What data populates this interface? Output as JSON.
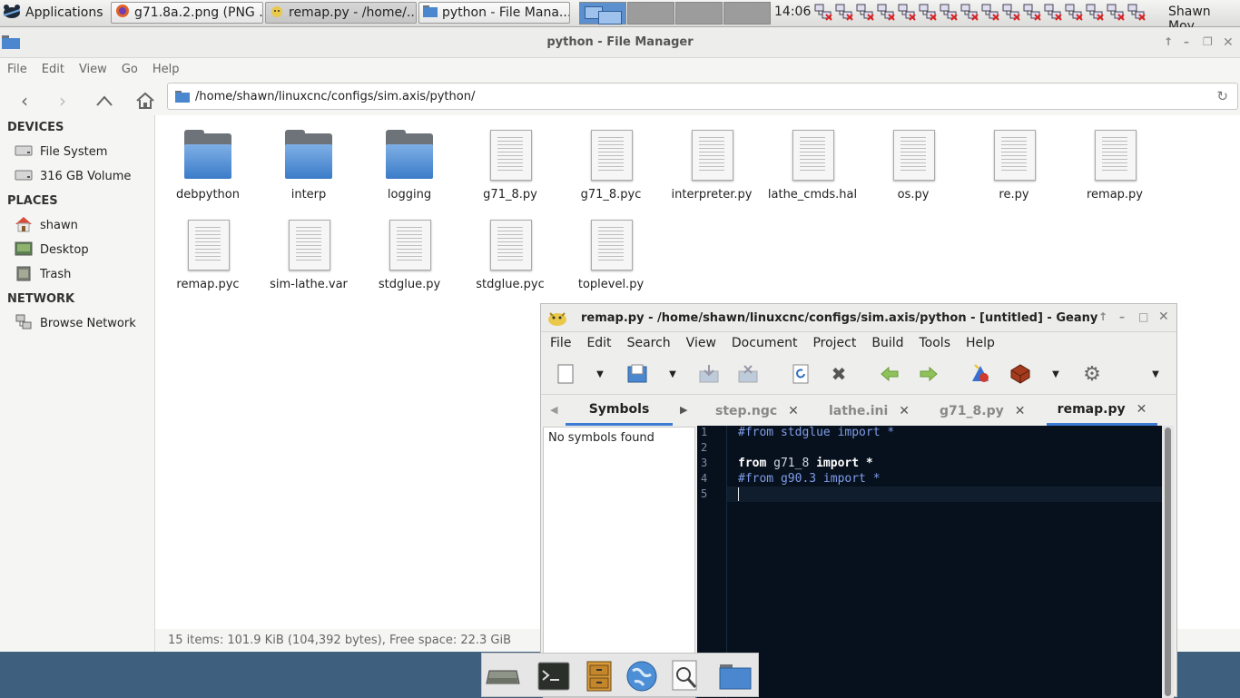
{
  "top_panel": {
    "apps_label": "Applications",
    "tasks": [
      {
        "label": "g71.8a.2.png (PNG ...",
        "icon": "firefox-icon"
      },
      {
        "label": "remap.py - /home/...",
        "icon": "geany-icon"
      },
      {
        "label": "python - File Mana...",
        "icon": "folder-icon"
      }
    ],
    "clock": "14:06",
    "user": "Shawn Moy"
  },
  "file_manager": {
    "title": "python - File Manager",
    "menu": [
      "File",
      "Edit",
      "View",
      "Go",
      "Help"
    ],
    "path": "/home/shawn/linuxcnc/configs/sim.axis/python/",
    "sidebar": {
      "devices_heading": "DEVICES",
      "devices": [
        "File System",
        "316 GB Volume"
      ],
      "places_heading": "PLACES",
      "places": [
        "shawn",
        "Desktop",
        "Trash"
      ],
      "network_heading": "NETWORK",
      "network": [
        "Browse Network"
      ]
    },
    "files": [
      {
        "name": "debpython",
        "type": "folder"
      },
      {
        "name": "interp",
        "type": "folder"
      },
      {
        "name": "logging",
        "type": "folder"
      },
      {
        "name": "g71_8.py",
        "type": "file"
      },
      {
        "name": "g71_8.pyc",
        "type": "file"
      },
      {
        "name": "interpreter.py",
        "type": "file"
      },
      {
        "name": "lathe_cmds.hal",
        "type": "file"
      },
      {
        "name": "os.py",
        "type": "file"
      },
      {
        "name": "re.py",
        "type": "file"
      },
      {
        "name": "remap.py",
        "type": "file"
      },
      {
        "name": "remap.pyc",
        "type": "file"
      },
      {
        "name": "sim-lathe.var",
        "type": "file"
      },
      {
        "name": "stdglue.py",
        "type": "file"
      },
      {
        "name": "stdglue.pyc",
        "type": "file"
      },
      {
        "name": "toplevel.py",
        "type": "file"
      }
    ],
    "status": "15 items: 101.9 KiB (104,392 bytes), Free space: 22.3 GiB"
  },
  "geany": {
    "title": "remap.py - /home/shawn/linuxcnc/configs/sim.axis/python - [untitled] - Geany",
    "menu": [
      "File",
      "Edit",
      "Search",
      "View",
      "Document",
      "Project",
      "Build",
      "Tools",
      "Help"
    ],
    "sidebar_tab": "Symbols",
    "symbols_text": "No symbols found",
    "tabs": [
      "step.ngc",
      "lathe.ini",
      "g71_8.py",
      "remap.py"
    ],
    "active_tab": "remap.py",
    "lines": [
      {
        "num": "1",
        "text": "#from stdglue import *"
      },
      {
        "num": "2",
        "text": ""
      },
      {
        "num": "3",
        "text": "from g71_8 import *"
      },
      {
        "num": "4",
        "text": "#from g90.3 import *"
      },
      {
        "num": "5",
        "text": ""
      }
    ],
    "colors": {
      "editor_bg": "#07111e",
      "comment": "#7f9be6"
    }
  },
  "dock": [
    "drive-icon",
    "terminal-icon",
    "file-cabinet-icon",
    "browser-globe-icon",
    "search-icon",
    "folder-icon"
  ]
}
